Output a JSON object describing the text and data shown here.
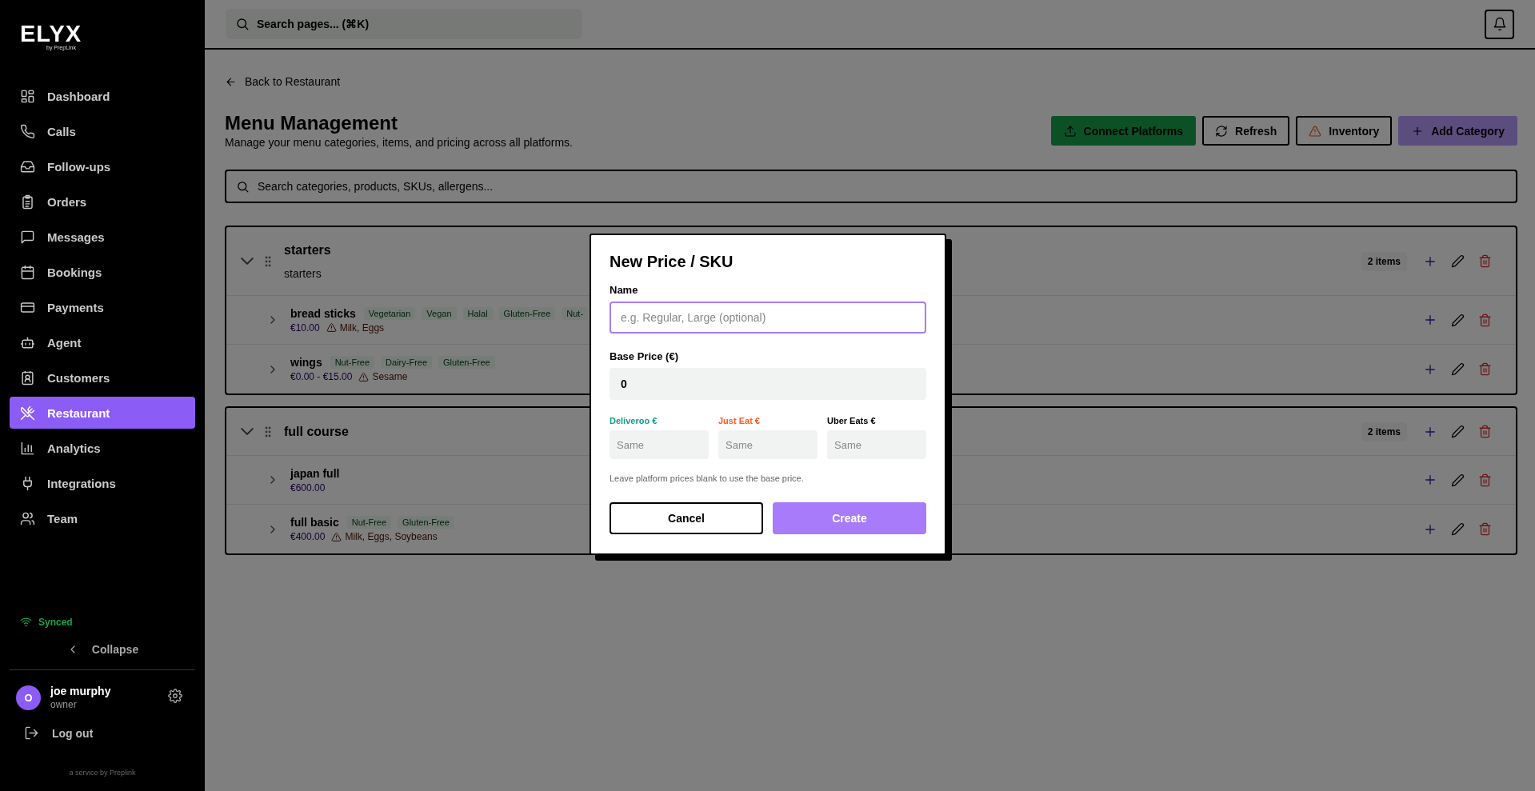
{
  "sidebar": {
    "logo": {
      "wordmark": "ELYX",
      "tagline": "by PrepLink"
    },
    "nav": [
      {
        "label": "Dashboard",
        "selected": false
      },
      {
        "label": "Calls",
        "selected": false
      },
      {
        "label": "Follow-ups",
        "selected": false
      },
      {
        "label": "Orders",
        "selected": false
      },
      {
        "label": "Messages",
        "selected": false
      },
      {
        "label": "Bookings",
        "selected": false
      },
      {
        "label": "Payments",
        "selected": false
      },
      {
        "label": "Agent",
        "selected": false
      },
      {
        "label": "Customers",
        "selected": false
      },
      {
        "label": "Restaurant",
        "selected": true
      },
      {
        "label": "Analytics",
        "selected": false
      },
      {
        "label": "Integrations",
        "selected": false
      },
      {
        "label": "Team",
        "selected": false
      }
    ],
    "sync_status": "Synced",
    "collapse": "Collapse",
    "user": {
      "initial": "O",
      "name": "joe murphy",
      "role": "owner"
    },
    "logout": "Log out",
    "footer": "a service by Preplink"
  },
  "header": {
    "search_placeholder": "Search pages... (⌘K)"
  },
  "page": {
    "back_link": "Back to Restaurant",
    "title": "Menu Management",
    "subtitle": "Manage your menu categories, items, and pricing across all platforms.",
    "actions": [
      {
        "label": "Connect Platforms",
        "kind": "success"
      },
      {
        "label": "Refresh",
        "kind": "outline"
      },
      {
        "label": "Inventory",
        "kind": "outline"
      },
      {
        "label": "Add Category",
        "kind": "primary"
      }
    ],
    "search_placeholder": "Search categories, products, SKUs, allergens..."
  },
  "categories": [
    {
      "name": "starters",
      "description": "starters",
      "count": "2 items",
      "expanded": true,
      "items": [
        {
          "name": "bread sticks",
          "tags": [
            "Vegetarian",
            "Vegan",
            "Halal",
            "Gluten-Free",
            "Nut-"
          ],
          "price": "€10.00",
          "allergens": "Milk, Eggs"
        },
        {
          "name": "wings",
          "tags": [
            "Nut-Free",
            "Dairy-Free",
            "Gluten-Free"
          ],
          "price": "€0.00 - €15.00",
          "allergens": "Sesame"
        }
      ]
    },
    {
      "name": "full course",
      "count": "2 items",
      "expanded": true,
      "items": [
        {
          "name": "japan full",
          "price": "€600.00"
        },
        {
          "name": "full basic",
          "tags": [
            "Nut-Free",
            "Gluten-Free"
          ],
          "price": "€400.00",
          "allergens": "Milk, Eggs, Soybeans"
        }
      ]
    }
  ],
  "modal": {
    "title": "New Price / SKU",
    "name_field": {
      "label": "Name",
      "placeholder": "e.g. Regular, Large (optional)",
      "focused": true
    },
    "base_price": {
      "label": "Base Price (€)",
      "value": "0"
    },
    "platforms": [
      {
        "label": "Deliveroo €",
        "color": "#0f9d8a",
        "placeholder": "Same"
      },
      {
        "label": "Just Eat €",
        "color": "#ff5a1f",
        "placeholder": "Same"
      },
      {
        "label": "Uber Eats €",
        "color": "#000000",
        "placeholder": "Same"
      }
    ],
    "hint": "Leave platform prices blank to use the base price.",
    "cancel": "Cancel",
    "create": "Create"
  }
}
